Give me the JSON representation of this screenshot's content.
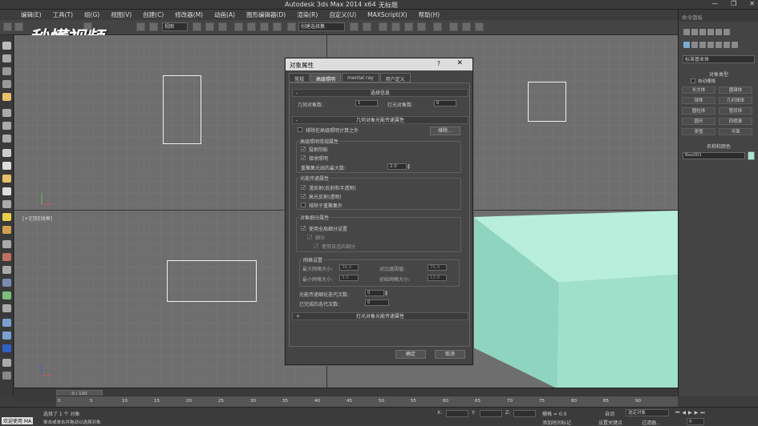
{
  "app": {
    "title": "Autodesk 3ds Max  2014 x64",
    "file": "无标题",
    "watermark": "秒懂视频"
  },
  "menu": [
    "编辑(E)",
    "工具(T)",
    "组(G)",
    "视图(V)",
    "创建(C)",
    "修改器(M)",
    "动画(A)",
    "图形编辑器(D)",
    "渲染(R)",
    "自定义(U)",
    "MAXScript(X)",
    "帮助(H)"
  ],
  "toolbar": {
    "view_combo": "视图",
    "select_combo": "创建选择集"
  },
  "viewport": {
    "label": "[+][顶][线框]"
  },
  "command_panel": {
    "search_placeholder": "命令面板",
    "category": "标准基本体",
    "object_type": "对象类型",
    "autogrid": "自动栅格",
    "primitives": [
      "长方体",
      "圆锥体",
      "球体",
      "几何球体",
      "圆柱体",
      "管状体",
      "圆环",
      "四棱锥",
      "茶壶",
      "平面"
    ],
    "name_color": "名称和颜色",
    "object_name": "Box001",
    "object_color": "#a8e6cf"
  },
  "dialog": {
    "title": "对象属性",
    "help": "?",
    "close": "✕",
    "tabs": [
      "常规",
      "高级照明",
      "mental ray",
      "用户定义"
    ],
    "active_tab": 1,
    "select_info": {
      "header": "选择信息",
      "geo_label": "几何对象数:",
      "geo_value": "1",
      "light_label": "灯光对象数:",
      "light_value": "0"
    },
    "geo_props": {
      "header": "几何对象光能传递属性",
      "exclude": "排除在高级照明计算之外",
      "exclude_btn": "排除…",
      "general_title": "高级照明常规属性",
      "cast_shadows": "投射阴影",
      "receive_illum": "接收照明",
      "bounces_label": "重聚集光线的最大数:",
      "bounces_value": "2.0"
    },
    "radiosity": {
      "title": "光能传递属性",
      "diffuse": "漫反射(反射和半透明)",
      "specular": "高光反射(透明)",
      "exclude_regather": "排除于重聚集外"
    },
    "subdiv": {
      "title": "对象细分属性",
      "use_global": "使用全局细分设置",
      "subdivide": "细分",
      "adaptive": "使用自适应细分"
    },
    "mesh": {
      "title": "网格设置",
      "max_label": "最大网格大小:",
      "max_value": "36.0",
      "min_label": "最小网格大小:",
      "min_value": "3.0",
      "contrast_label": "对比度阈值:",
      "contrast_value": "75.0",
      "initial_label": "初始网格大小:",
      "initial_value": "12.0"
    },
    "refine_label": "光能传递细化迭代次数:",
    "refine_value": "0",
    "done_label": "已完成的迭代次数:",
    "done_value": "0",
    "light_props": "灯光对象光能传递属性",
    "ok": "确定",
    "cancel": "取消"
  },
  "timeline": {
    "frame": "0 / 100",
    "ticks": [
      "0",
      "5",
      "10",
      "15",
      "20",
      "25",
      "30",
      "35",
      "40",
      "45",
      "50",
      "55",
      "60",
      "65",
      "70",
      "75",
      "80",
      "85",
      "90"
    ]
  },
  "status": {
    "welcome": "欢迎使用 MA",
    "selected": "选择了 1 个 对象",
    "hint": "单击或单击并拖动以选择对象",
    "x_label": "X:",
    "y_label": "Y:",
    "z_label": "Z:",
    "grid": "栅格 = 0.0",
    "autokey": "自动",
    "setkey": "设置关键点",
    "selobj": "选定对象",
    "filter": "过滤器...",
    "addtime": "添加时间标记",
    "frame_field": "0"
  }
}
